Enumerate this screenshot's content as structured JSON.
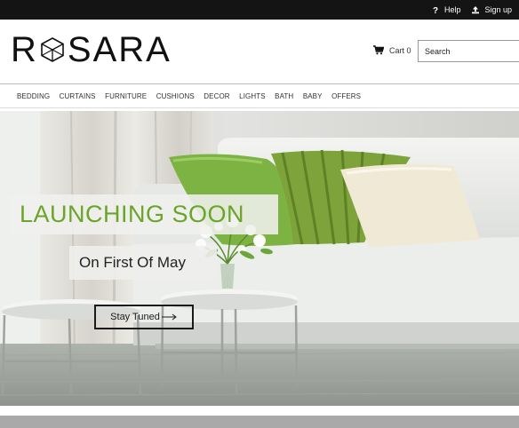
{
  "topbar": {
    "help_label": "Help",
    "signup_label": "Sign up"
  },
  "header": {
    "brand": {
      "first": "R",
      "rest": "SARA"
    },
    "cart_label": "Cart 0",
    "search_placeholder": "Search"
  },
  "nav": {
    "items": [
      "BEDDING",
      "CURTAINS",
      "FURNITURE",
      "CUSHIONS",
      "DECOR",
      "LIGHTS",
      "BATH",
      "BABY",
      "OFFERS"
    ]
  },
  "hero": {
    "headline": "LAUNCHING SOON",
    "subheadline": "On First Of May",
    "cta_label": "Stay Tuned",
    "colors": {
      "accent": "#6aa52a",
      "cushion_green": "#7cb342",
      "cushion_cream": "#efe9d6"
    }
  }
}
